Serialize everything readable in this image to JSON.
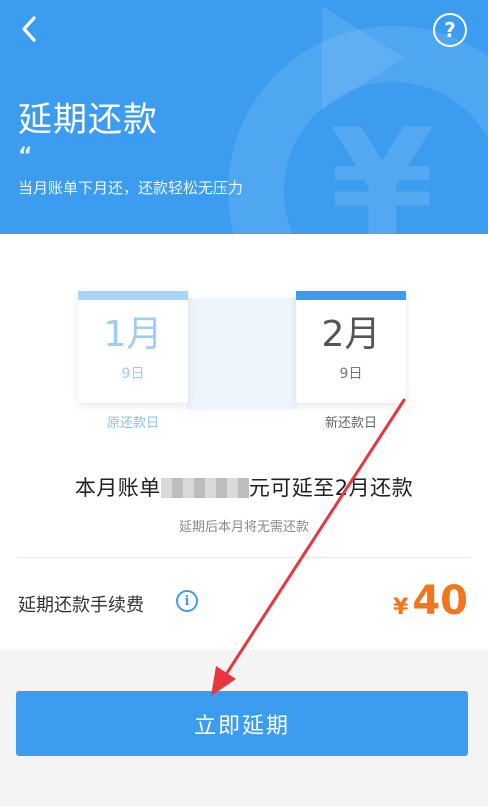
{
  "header": {
    "title": "延期还款",
    "quote_mark": "“",
    "subtitle": "当月账单下月还，还款轻松无压力",
    "help_symbol": "?"
  },
  "calendar": {
    "old": {
      "month": "1月",
      "day": "9日",
      "label": "原还款日"
    },
    "new": {
      "month": "2月",
      "day": "9日",
      "label": "新还款日"
    }
  },
  "info": {
    "headline_prefix": "本月账单",
    "headline_suffix": "元可延至2月还款",
    "note": "延期后本月将无需还款"
  },
  "fee": {
    "label": "延期还款手续费",
    "currency": "¥",
    "amount": "40",
    "info_symbol": "i"
  },
  "action": {
    "confirm_label": "立即延期"
  },
  "colors": {
    "primary": "#3c9cf0",
    "amount": "#f5741e",
    "annotation_arrow": "#e8363f"
  },
  "icons": {
    "back": "chevron-left-icon",
    "help": "question-circle-icon",
    "info": "info-circle-icon"
  }
}
